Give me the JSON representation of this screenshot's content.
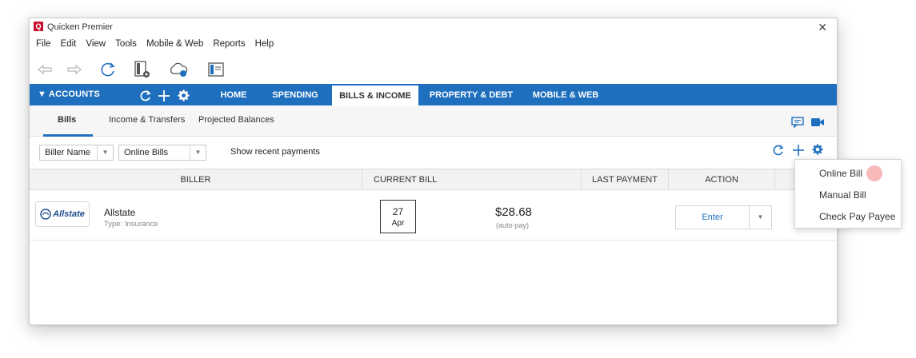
{
  "window": {
    "title": "Quicken Premier",
    "logo_letter": "Q"
  },
  "menu": [
    "File",
    "Edit",
    "View",
    "Tools",
    "Mobile & Web",
    "Reports",
    "Help"
  ],
  "nav": {
    "accounts_label": "▼  ACCOUNTS",
    "tabs": [
      "HOME",
      "SPENDING",
      "BILLS & INCOME",
      "PROPERTY & DEBT",
      "MOBILE & WEB"
    ],
    "active_tab": "BILLS & INCOME"
  },
  "subtabs": [
    "Bills",
    "Income & Transfers",
    "Projected Balances"
  ],
  "filters": {
    "biller_select": "Biller Name",
    "type_select": "Online Bills",
    "show_recent": "Show recent payments"
  },
  "table": {
    "headers": [
      "BILLER",
      "CURRENT BILL",
      "LAST PAYMENT",
      "ACTION"
    ],
    "rows": [
      {
        "logo_text": "Allstate",
        "name": "Allstate",
        "type": "Type: Insurance",
        "due_day": "27",
        "due_month": "Apr",
        "amount": "$28.68",
        "note": "(auto-pay)",
        "action": "Enter"
      }
    ]
  },
  "add_menu": [
    "Online Bill",
    "Manual Bill",
    "Check Pay Payee"
  ],
  "colors": {
    "accent": "#1f6fbf",
    "brand": "#c8102e"
  }
}
